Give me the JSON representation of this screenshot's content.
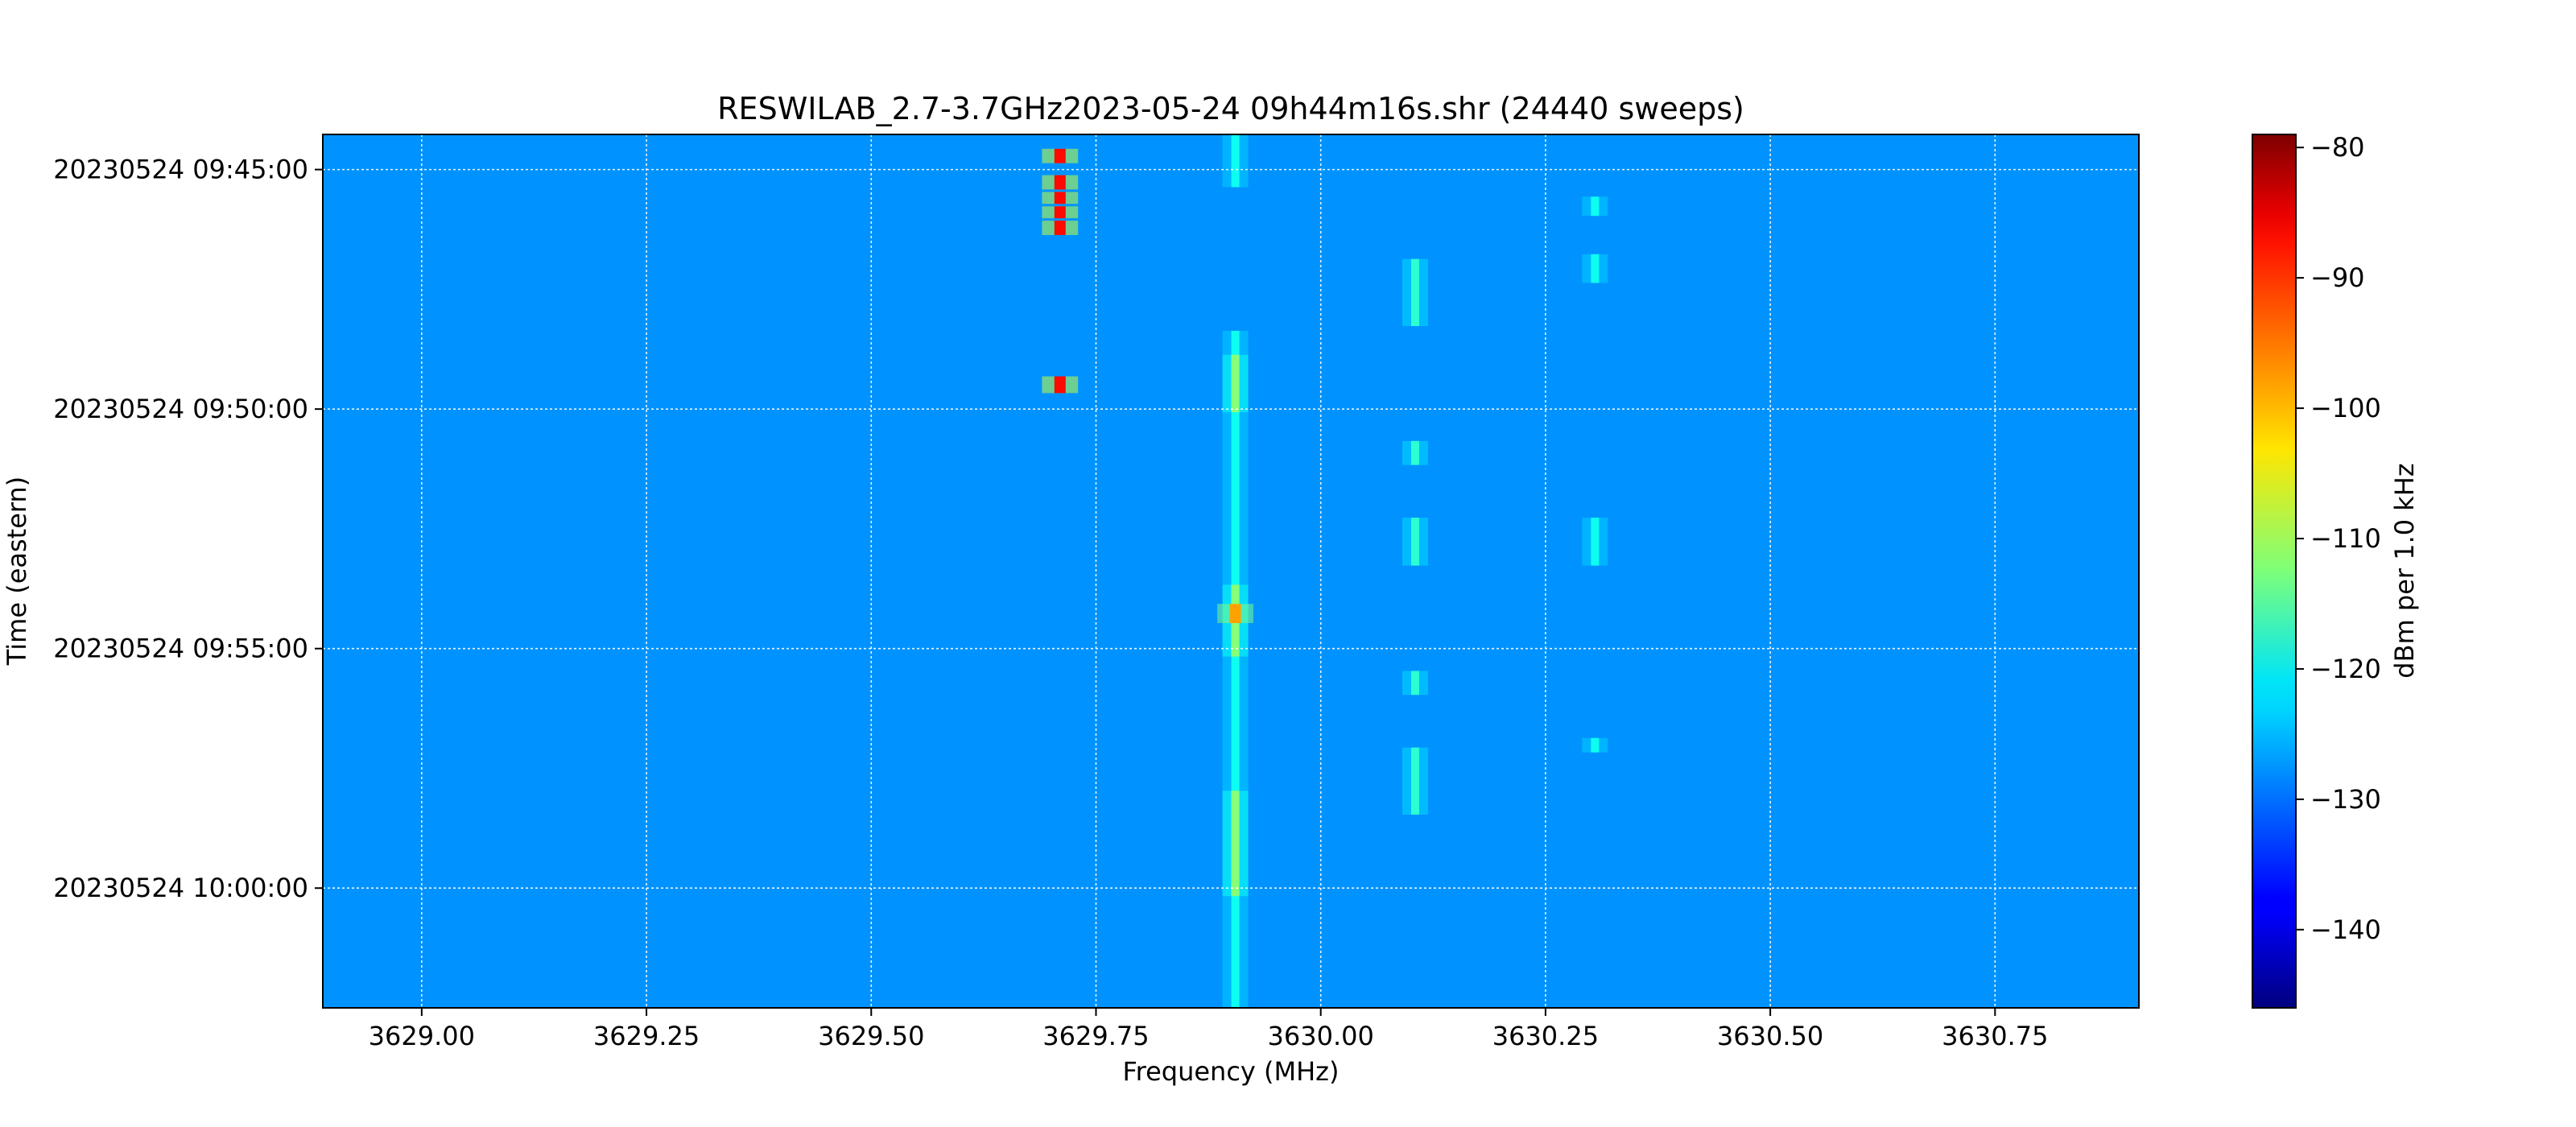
{
  "chart_data": {
    "type": "heatmap",
    "title": "RESWILAB_2.7-3.7GHz2023-05-24 09h44m16s.shr (24440 sweeps)",
    "xlabel": "Frequency (MHz)",
    "ylabel": "Time (eastern)",
    "colorbar_label": "dBm per 1.0 kHz",
    "colormap": "jet",
    "xlim": [
      3628.89,
      3630.91
    ],
    "ylim_time": [
      "20230524 09:44:16",
      "20230524 10:02:30"
    ],
    "x_ticks": [
      3629.0,
      3629.25,
      3629.5,
      3629.75,
      3630.0,
      3630.25,
      3630.5,
      3630.75
    ],
    "x_tick_labels": [
      "3629.00",
      "3629.25",
      "3629.50",
      "3629.75",
      "3630.00",
      "3630.25",
      "3630.50",
      "3630.75"
    ],
    "y_tick_labels": [
      "20230524 09:45:00",
      "20230524 09:50:00",
      "20230524 09:55:00",
      "20230524 10:00:00"
    ],
    "y_tick_minutes": [
      0.733,
      5.733,
      10.733,
      15.733
    ],
    "y_range_minutes": 18.233,
    "colorbar_range": [
      -146,
      -79
    ],
    "colorbar_ticks": [
      -80,
      -90,
      -100,
      -110,
      -120,
      -130,
      -140
    ],
    "colorbar_tick_labels": [
      "−80",
      "−90",
      "−100",
      "−110",
      "−120",
      "−130",
      "−140"
    ],
    "background_level": -128,
    "grid": true,
    "signals": [
      {
        "freq_mhz": 3629.905,
        "minutes": [
          [
            0.0,
            1.1
          ],
          [
            4.1,
            18.233
          ]
        ],
        "level": -120,
        "comment": "persistent carrier"
      },
      {
        "freq_mhz": 3629.905,
        "minutes": [
          [
            4.6,
            5.8
          ],
          [
            9.4,
            10.9
          ],
          [
            13.7,
            15.9
          ]
        ],
        "level": -112
      },
      {
        "freq_mhz": 3629.905,
        "minutes": [
          [
            9.8,
            10.2
          ]
        ],
        "level": -98
      },
      {
        "freq_mhz": 3629.71,
        "minutes": [
          [
            0.3,
            0.6
          ],
          [
            0.85,
            1.15
          ],
          [
            1.2,
            1.45
          ],
          [
            1.5,
            1.75
          ],
          [
            1.8,
            2.1
          ],
          [
            5.05,
            5.4
          ]
        ],
        "level": -88
      },
      {
        "freq_mhz": 3630.105,
        "minutes": [
          [
            2.6,
            4.0
          ],
          [
            6.4,
            6.9
          ],
          [
            8.0,
            9.0
          ],
          [
            11.2,
            11.7
          ],
          [
            12.8,
            14.2
          ]
        ],
        "level": -118
      },
      {
        "freq_mhz": 3630.305,
        "minutes": [
          [
            1.3,
            1.7
          ],
          [
            2.5,
            3.1
          ],
          [
            8.0,
            9.0
          ],
          [
            12.6,
            12.9
          ]
        ],
        "level": -120
      }
    ]
  }
}
